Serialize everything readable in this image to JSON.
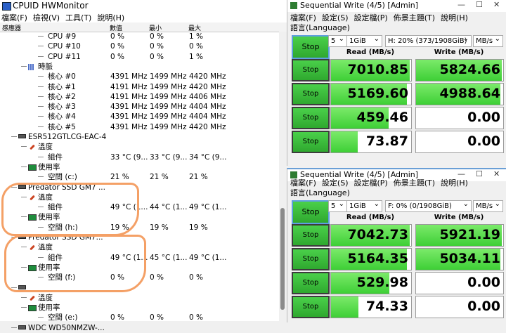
{
  "hwmonitor": {
    "title": "CPUID HWMonitor",
    "menu": [
      "檔案(F)",
      "檢視(V)",
      "工具(T)",
      "說明(H)"
    ],
    "columns": [
      "感應器",
      "數值",
      "最小",
      "最大"
    ],
    "rows": [
      {
        "indent": 3,
        "icon": "",
        "label": "CPU #9",
        "value": "0 %",
        "min": "0 %",
        "max": "1 %"
      },
      {
        "indent": 3,
        "icon": "",
        "label": "CPU #10",
        "value": "0 %",
        "min": "0 %",
        "max": "0 %"
      },
      {
        "indent": 3,
        "icon": "",
        "label": "CPU #11",
        "value": "0 %",
        "min": "0 %",
        "max": "1 %"
      },
      {
        "indent": 2,
        "icon": "grid",
        "label": "時脈",
        "value": "",
        "min": "",
        "max": ""
      },
      {
        "indent": 3,
        "icon": "",
        "label": "核心 #0",
        "value": "4391 MHz",
        "min": "1499 MHz",
        "max": "4420 MHz"
      },
      {
        "indent": 3,
        "icon": "",
        "label": "核心 #1",
        "value": "4191 MHz",
        "min": "1499 MHz",
        "max": "4420 MHz"
      },
      {
        "indent": 3,
        "icon": "",
        "label": "核心 #2",
        "value": "4191 MHz",
        "min": "1499 MHz",
        "max": "4406 MHz"
      },
      {
        "indent": 3,
        "icon": "",
        "label": "核心 #3",
        "value": "4391 MHz",
        "min": "1499 MHz",
        "max": "4404 MHz"
      },
      {
        "indent": 3,
        "icon": "",
        "label": "核心 #4",
        "value": "4391 MHz",
        "min": "1499 MHz",
        "max": "4404 MHz"
      },
      {
        "indent": 3,
        "icon": "",
        "label": "核心 #5",
        "value": "4391 MHz",
        "min": "1499 MHz",
        "max": "4420 MHz"
      },
      {
        "indent": 1,
        "icon": "drive",
        "label": "ESR512GTLCG-EAC-4",
        "value": "",
        "min": "",
        "max": ""
      },
      {
        "indent": 2,
        "icon": "therm",
        "label": "溫度",
        "value": "",
        "min": "",
        "max": ""
      },
      {
        "indent": 3,
        "icon": "",
        "label": "組件",
        "value": "33 °C (9...",
        "min": "33 °C (9...",
        "max": "34 °C (9..."
      },
      {
        "indent": 2,
        "icon": "bar",
        "label": "使用率",
        "value": "",
        "min": "",
        "max": ""
      },
      {
        "indent": 3,
        "icon": "",
        "label": "空間 (c:)",
        "value": "21 %",
        "min": "21 %",
        "max": "21 %"
      },
      {
        "indent": 1,
        "icon": "drive",
        "label": "Predator SSD GM7 ...",
        "value": "",
        "min": "",
        "max": ""
      },
      {
        "indent": 2,
        "icon": "therm",
        "label": "溫度",
        "value": "",
        "min": "",
        "max": ""
      },
      {
        "indent": 3,
        "icon": "",
        "label": "組件",
        "value": "49 °C (1...",
        "min": "44 °C (1...",
        "max": "49 °C (1..."
      },
      {
        "indent": 2,
        "icon": "bar",
        "label": "使用率",
        "value": "",
        "min": "",
        "max": ""
      },
      {
        "indent": 3,
        "icon": "",
        "label": "空間 (h:)",
        "value": "19 %",
        "min": "19 %",
        "max": "19 %"
      },
      {
        "indent": 1,
        "icon": "drive",
        "label": "Predator SSD GM7...",
        "value": "",
        "min": "",
        "max": ""
      },
      {
        "indent": 2,
        "icon": "therm",
        "label": "溫度",
        "value": "",
        "min": "",
        "max": ""
      },
      {
        "indent": 3,
        "icon": "",
        "label": "組件",
        "value": "49 °C (1...",
        "min": "45 °C (1...",
        "max": "49 °C (1..."
      },
      {
        "indent": 2,
        "icon": "bar",
        "label": "使用率",
        "value": "",
        "min": "",
        "max": ""
      },
      {
        "indent": 3,
        "icon": "",
        "label": "空間 (f:)",
        "value": "0 %",
        "min": "0 %",
        "max": "0 %"
      },
      {
        "indent": 1,
        "icon": "drive",
        "label": "",
        "value": "",
        "min": "",
        "max": ""
      },
      {
        "indent": 2,
        "icon": "therm",
        "label": "溫度",
        "value": "",
        "min": "",
        "max": ""
      },
      {
        "indent": 2,
        "icon": "bar",
        "label": "使用率",
        "value": "",
        "min": "",
        "max": ""
      },
      {
        "indent": 3,
        "icon": "",
        "label": "空間 (e:)",
        "value": "0 %",
        "min": "0 %",
        "max": "0 %"
      },
      {
        "indent": 1,
        "icon": "drive",
        "label": "WDC WD50NMZW-...",
        "value": "",
        "min": "",
        "max": ""
      }
    ]
  },
  "seqwrite": [
    {
      "title": "Sequential Write (4/5) [Admin]",
      "menu": [
        "檔案(F)",
        "設定(S)",
        "設定檔(P)",
        "佈景主題(T)",
        "說明(H)"
      ],
      "lang": "語言(Language)",
      "count": "5",
      "size": "1GiB",
      "drive": "H: 20% (373/1908GiB)",
      "unit": "MB/s",
      "stop_label": "Stop",
      "read_header": "Read (MB/s)",
      "write_header": "Write (MB/s)",
      "rows": [
        {
          "button": "Stop",
          "read": "7010.85",
          "read_fill": 0.98,
          "write": "5824.66",
          "write_fill": 0.98
        },
        {
          "button": "Stop",
          "read": "5169.60",
          "read_fill": 0.95,
          "write": "4988.64",
          "write_fill": 0.97
        },
        {
          "button": "Stop",
          "read": "459.46",
          "read_fill": 0.72,
          "write": "0.00",
          "write_fill": 0
        },
        {
          "button": "Stop",
          "read": "73.87",
          "read_fill": 0.33,
          "write": "0.00",
          "write_fill": 0
        }
      ]
    },
    {
      "title": "Sequential Write (4/5) [Admin]",
      "menu": [
        "檔案(F)",
        "設定(S)",
        "設定檔(P)",
        "佈景主題(T)",
        "說明(H)"
      ],
      "lang": "語言(Language)",
      "count": "5",
      "size": "1GiB",
      "drive": "F: 0% (0/1908GiB)",
      "unit": "MB/s",
      "stop_label": "Stop",
      "read_header": "Read (MB/s)",
      "write_header": "Write (MB/s)",
      "rows": [
        {
          "button": "Stop",
          "read": "7042.73",
          "read_fill": 0.98,
          "write": "5921.19",
          "write_fill": 0.98
        },
        {
          "button": "Stop",
          "read": "5164.35",
          "read_fill": 0.95,
          "write": "5034.11",
          "write_fill": 0.97
        },
        {
          "button": "Stop",
          "read": "529.98",
          "read_fill": 0.73,
          "write": "0.00",
          "write_fill": 0
        },
        {
          "button": "Stop",
          "read": "74.33",
          "read_fill": 0.34,
          "write": "0.00",
          "write_fill": 0
        }
      ]
    }
  ],
  "colors": {
    "progress_green": "#3ecf36",
    "annotation_orange": "#f4a066"
  }
}
